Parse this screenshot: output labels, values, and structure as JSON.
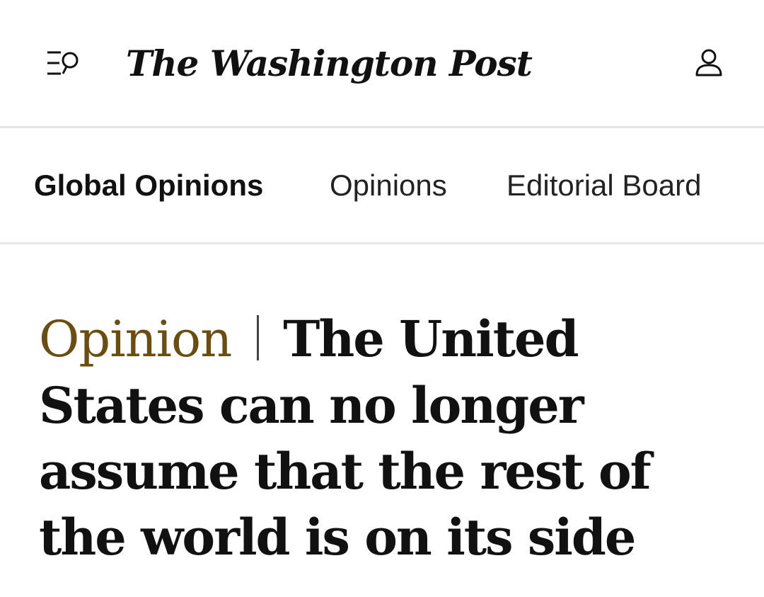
{
  "header": {
    "masthead": "The Washington Post",
    "menu_icon": "menu-search-icon",
    "account_icon": "user-icon"
  },
  "subnav": {
    "items": [
      {
        "label": "Global Opinions",
        "active": true
      },
      {
        "label": "Opinions",
        "active": false
      },
      {
        "label": "Editorial Board",
        "active": false
      }
    ]
  },
  "article": {
    "kicker": "Opinion",
    "title": "The United States can no longer assume that the rest of the world is on its side"
  },
  "colors": {
    "kicker": "#6b4d10",
    "text": "#111111",
    "divider": "#e6e6e6"
  }
}
